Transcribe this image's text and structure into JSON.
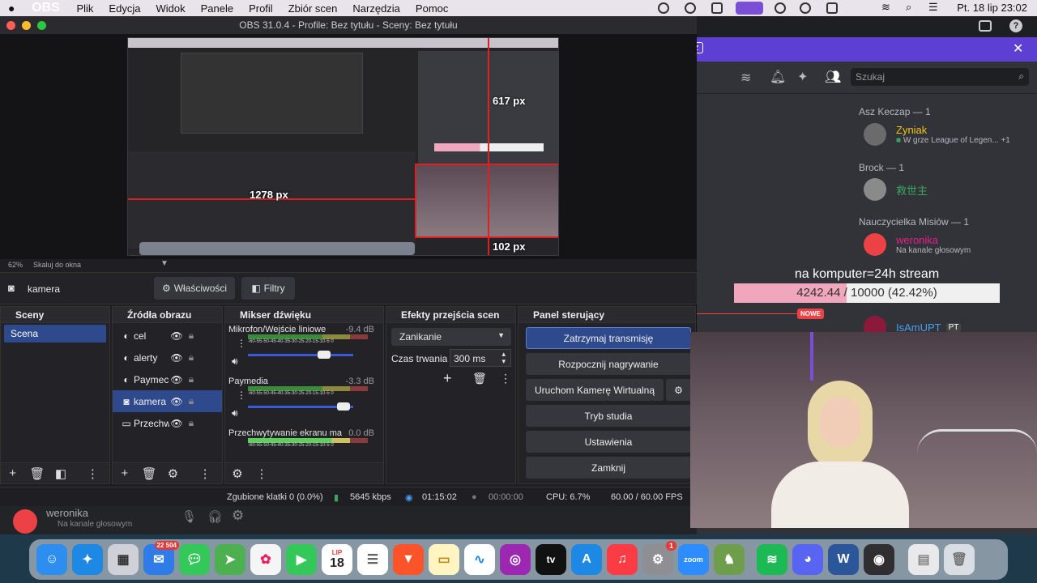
{
  "menubar": {
    "apple": "",
    "app": "OBS",
    "items": [
      "Plik",
      "Edycja",
      "Widok",
      "Panele",
      "Profil",
      "Zbiór scen",
      "Narzędzia",
      "Pomoc"
    ],
    "datetime": "Pt. 18 lip  23:02"
  },
  "obs": {
    "title": "OBS 31.0.4 - Profile: Bez tytułu - Sceny: Bez tytułu",
    "zoom": "62%",
    "scale_mode": "Skaluj do okna",
    "measure_h": "617 px",
    "measure_w": "1278 px",
    "measure_b": "102 px",
    "selected_source": "kamera",
    "props_btn": "Właściwości",
    "filters_btn": "Filtry",
    "docks": {
      "scenes": "Sceny",
      "sources": "Źródła obrazu",
      "mixer": "Mikser dźwięku",
      "transitions": "Efekty przejścia scen",
      "controls": "Panel sterujący"
    },
    "scenes": [
      "Scena"
    ],
    "sources": [
      "cel",
      "alerty",
      "Paymec",
      "kamera",
      "Przechw"
    ],
    "mixer": [
      {
        "name": "Mikrofon/Wejście liniowe",
        "db": "-9.4 dB"
      },
      {
        "name": "Paymedia",
        "db": "-3.3 dB"
      },
      {
        "name": "Przechwytywanie ekranu ma",
        "db": "0.0 dB"
      }
    ],
    "meter_ticks": "-60-55-50-45-40-35-30-25-20-15-10-5  0",
    "transition": "Zanikanie",
    "duration_label": "Czas trwania",
    "duration": "300 ms",
    "controls": [
      "Zatrzymaj transmisję",
      "Rozpocznij nagrywanie",
      "Uruchom Kamerę Wirtualną",
      "Tryb studia",
      "Ustawienia",
      "Zamknij"
    ],
    "status": {
      "dropped": "Zgubione klatki 0 (0.0%)",
      "bitrate": "5645 kbps",
      "stream_time": "01:15:02",
      "rec_time": "00:00:00",
      "cpu": "CPU: 6.7%",
      "fps": "60.00 / 60.00 FPS"
    }
  },
  "discord": {
    "search": "Szukaj",
    "banner_text": "z",
    "sections": [
      {
        "title": "Asz Keczap — 1",
        "user": "Zyniak",
        "sub": "W grze League of Legen...",
        "extra": "+1",
        "color": "#f0c419"
      },
      {
        "title": "Brock — 1",
        "user": "救世主",
        "sub": "",
        "extra": "",
        "color": "#3ba55c"
      },
      {
        "title": "Nauczycielka Misiów — 1",
        "user": "weronika",
        "sub": "Na kanale głosowym",
        "extra": "",
        "color": "#e91e8c"
      }
    ],
    "new_badge": "NOWE",
    "last_user": "IsAmUPT",
    "last_tag": "PT",
    "bottom_user": "weronika",
    "bottom_sub": "Na kanale głosowym"
  },
  "overlay": {
    "goal_title": "na komputer=24h stream",
    "goal_text": "4242.44 / 10000 (42.42%)",
    "goal_progress": 0.4242
  },
  "dock": {
    "mail_badge": "22 504",
    "calendar_month": "LIP",
    "calendar_day": "18",
    "settings_badge": "1",
    "zoom_label": "zoom"
  }
}
